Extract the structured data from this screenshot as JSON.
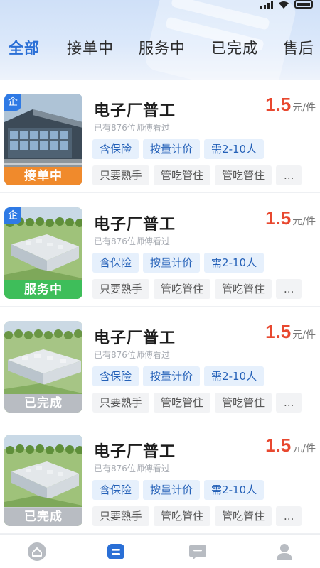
{
  "tabs": [
    {
      "label": "全部",
      "active": true
    },
    {
      "label": "接单中",
      "active": false
    },
    {
      "label": "服务中",
      "active": false
    },
    {
      "label": "已完成",
      "active": false
    },
    {
      "label": "售后",
      "active": false
    }
  ],
  "jobs": [
    {
      "title": "电子厂普工",
      "price": "1.5",
      "price_unit": "元/件",
      "views": "已有876位师傅看过",
      "enterprise_badge": "企",
      "status": "接单中",
      "status_color": "#f08a2c",
      "tags_primary": [
        "含保险",
        "按量计价",
        "需2-10人"
      ],
      "tags_secondary": [
        "只要熟手",
        "管吃管住",
        "管吃管住",
        "..."
      ]
    },
    {
      "title": "电子厂普工",
      "price": "1.5",
      "price_unit": "元/件",
      "views": "已有876位师傅看过",
      "enterprise_badge": "企",
      "status": "服务中",
      "status_color": "#3ebe5a",
      "tags_primary": [
        "含保险",
        "按量计价",
        "需2-10人"
      ],
      "tags_secondary": [
        "只要熟手",
        "管吃管住",
        "管吃管住",
        "..."
      ]
    },
    {
      "title": "电子厂普工",
      "price": "1.5",
      "price_unit": "元/件",
      "views": "已有876位师傅看过",
      "enterprise_badge": "",
      "status": "已完成",
      "status_color": "#b8bcc2",
      "tags_primary": [
        "含保险",
        "按量计价",
        "需2-10人"
      ],
      "tags_secondary": [
        "只要熟手",
        "管吃管住",
        "管吃管住",
        "..."
      ]
    },
    {
      "title": "电子厂普工",
      "price": "1.5",
      "price_unit": "元/件",
      "views": "已有876位师傅看过",
      "enterprise_badge": "",
      "status": "已完成",
      "status_color": "#b8bcc2",
      "tags_primary": [
        "含保险",
        "按量计价",
        "需2-10人"
      ],
      "tags_secondary": [
        "只要熟手",
        "管吃管住",
        "管吃管住",
        "..."
      ]
    }
  ],
  "bottom_nav": [
    {
      "icon": "home-icon",
      "active": false
    },
    {
      "icon": "orders-icon",
      "active": true
    },
    {
      "icon": "message-icon",
      "active": false
    },
    {
      "icon": "profile-icon",
      "active": false
    }
  ],
  "colors": {
    "accent": "#2a6fd6",
    "price": "#e8482f",
    "nav_inactive": "#b8bcc2"
  }
}
